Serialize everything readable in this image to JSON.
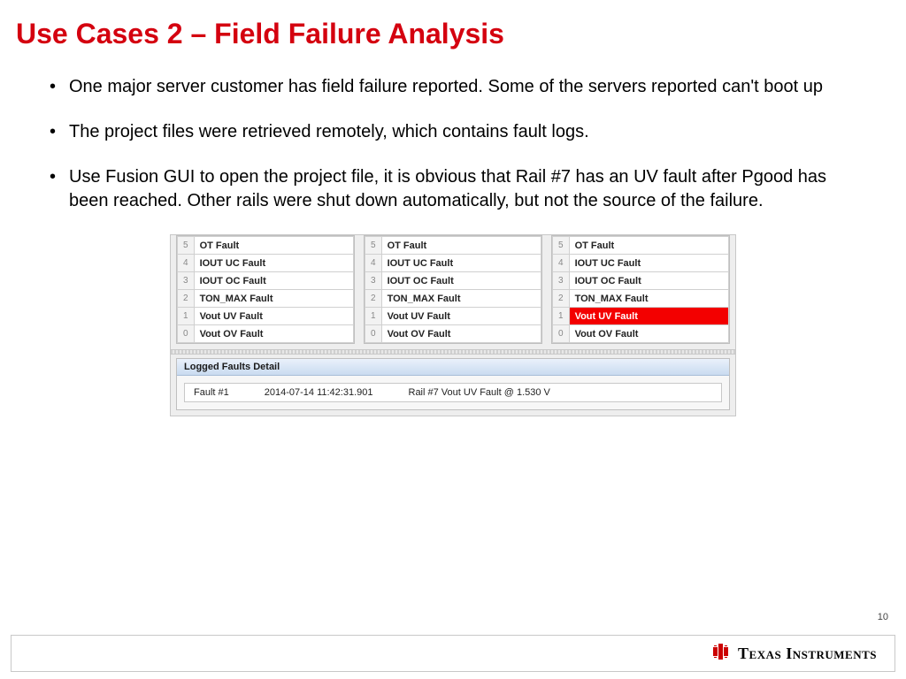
{
  "title": "Use Cases 2 – Field Failure Analysis",
  "bullets": [
    "One major server customer has field failure reported. Some of the servers reported can't boot up",
    "The project files were retrieved remotely, which contains fault logs.",
    "Use Fusion GUI to open the project file, it is obvious that Rail #7 has an UV fault after Pgood has been reached. Other rails were shut down automatically, but not the source of the failure."
  ],
  "fault_rows": [
    {
      "idx": "5",
      "label": "OT Fault"
    },
    {
      "idx": "4",
      "label": "IOUT UC Fault"
    },
    {
      "idx": "3",
      "label": "IOUT OC Fault"
    },
    {
      "idx": "2",
      "label": "TON_MAX Fault"
    },
    {
      "idx": "1",
      "label": "Vout UV Fault"
    },
    {
      "idx": "0",
      "label": "Vout OV Fault"
    }
  ],
  "highlight_panel_index": 2,
  "highlight_row_idx": "1",
  "detail": {
    "header": "Logged Faults Detail",
    "fault_label": "Fault #1",
    "timestamp": "2014-07-14 11:42:31.901",
    "description": "Rail #7 Vout UV Fault @ 1.530 V"
  },
  "page_number": "10",
  "brand": "Texas Instruments"
}
